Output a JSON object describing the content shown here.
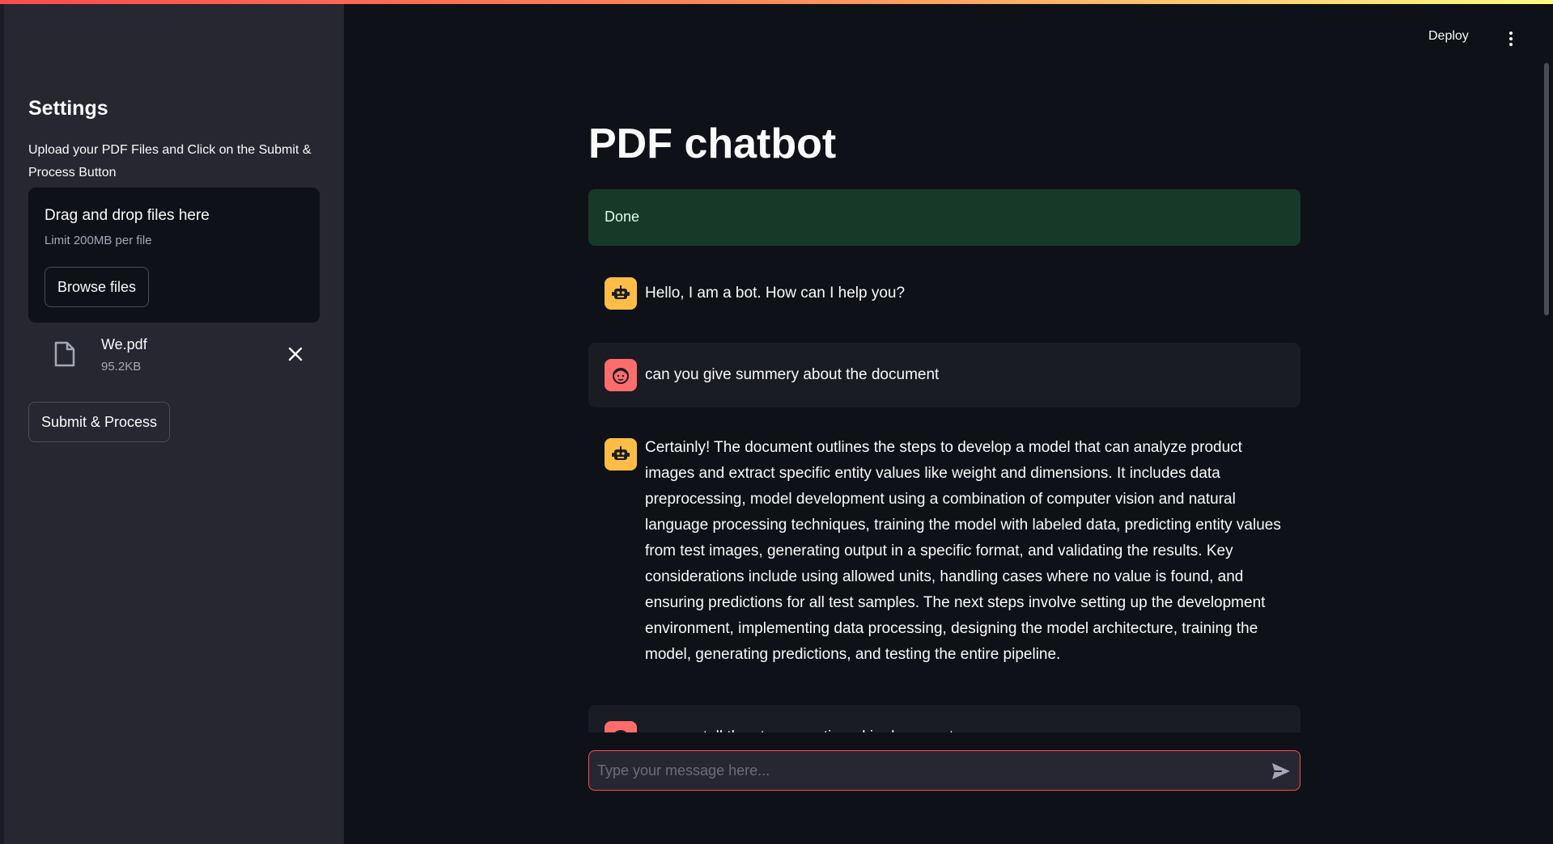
{
  "header": {
    "deploy_label": "Deploy",
    "menu_icon": "kebab-menu-icon"
  },
  "sidebar": {
    "title": "Settings",
    "description": "Upload your PDF Files and Click on the Submit & Process Button",
    "uploader": {
      "drop_label": "Drag and drop files here",
      "limit_label": "Limit 200MB per file",
      "browse_label": "Browse files"
    },
    "file": {
      "name": "We.pdf",
      "size": "95.2KB"
    },
    "submit_label": "Submit & Process"
  },
  "main": {
    "title": "PDF chatbot",
    "status": "Done",
    "messages": [
      {
        "role": "bot",
        "text": "Hello, I am a bot. How can I help you?"
      },
      {
        "role": "user",
        "text": "can you give summery about the document"
      },
      {
        "role": "bot",
        "text": "Certainly! The document outlines the steps to develop a model that can analyze product images and extract specific entity values like weight and dimensions. It includes data preprocessing, model development using a combination of computer vision and natural language processing techniques, training the model with labeled data, predicting entity values from test images, generating output in a specific format, and validating the results. Key considerations include using allowed units, handling cases where no value is found, and ensuring predictions for all test samples. The next steps involve setting up the development environment, implementing data processing, designing the model architecture, training the model, generating predictions, and testing the entire pipeline."
      },
      {
        "role": "user",
        "text": "can you tell the steps mentioned in document"
      }
    ],
    "input_placeholder": "Type your message here..."
  },
  "colors": {
    "accent": "#ff4b4b",
    "bot_avatar": "#ffbd45",
    "user_avatar": "#ff6c6c",
    "success_bg": "#173928"
  }
}
